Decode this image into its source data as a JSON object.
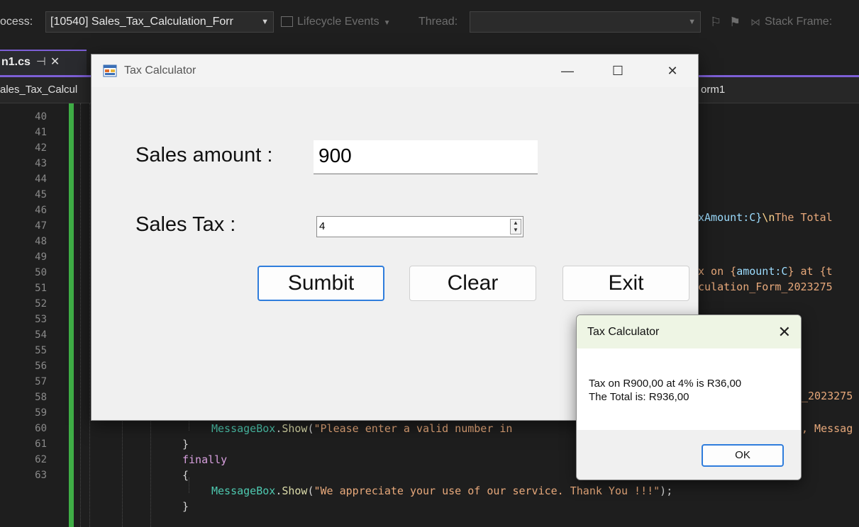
{
  "toolbar": {
    "process_label": "ocess:",
    "process_value": "[10540] Sales_Tax_Calculation_Forr",
    "lifecycle_label": "Lifecycle Events",
    "thread_label": "Thread:",
    "thread_value": "",
    "stackframe_label": "Stack Frame:"
  },
  "tab": {
    "name": "n1.cs",
    "pin": "⊣",
    "close": "✕"
  },
  "navbar": {
    "left": "ales_Tax_Calcul",
    "right": "orm1"
  },
  "editor": {
    "line_numbers": [
      "40",
      "41",
      "42",
      "43",
      "44",
      "45",
      "46",
      "47",
      "48",
      "49",
      "50",
      "51",
      "52",
      "53",
      "54",
      "55",
      "56",
      "57",
      "58",
      "59",
      "60",
      "61",
      "62",
      "63"
    ],
    "frag_46": "xAmount:C}",
    "frag_46_esc": "\\n",
    "frag_46_tail": "The Total",
    "frag_49_a": "x on {",
    "frag_49_b": "amount:C",
    "frag_49_c": "} at {t",
    "frag_50": "culation_Form_2023275",
    "frag_56": "_2023275",
    "line58_call": "MessageBox",
    "line58_dot": ".",
    "line58_method": "Show",
    "line58_paren": "(",
    "line58_string": "\"Please enter a valid number in",
    "line58_tail": ", Messag",
    "line59": "}",
    "line60": "finally",
    "line61": "{",
    "line62_call": "MessageBox",
    "line62_dot": ".",
    "line62_method": "Show",
    "line62_paren": "(",
    "line62_string": "\"We appreciate your use of our service. Thank You !!!\"",
    "line62_end": ");",
    "line63": "}"
  },
  "main_window": {
    "title": "Tax Calculator",
    "minimize": "—",
    "maximize": "☐",
    "close": "✕",
    "sales_amount_label": "Sales amount :",
    "sales_amount_value": "900",
    "sales_tax_label": "Sales Tax :",
    "sales_tax_value": "4",
    "submit_label": "Sumbit",
    "clear_label": "Clear",
    "exit_label": "Exit"
  },
  "message_box": {
    "title": "Tax Calculator",
    "close": "✕",
    "line1": "Tax on R900,00 at 4% is R36,00",
    "line2": "The Total is: R936,00",
    "ok_label": "OK"
  },
  "colors": {
    "accent": "#7d5fd6",
    "change_bar": "#3fae46",
    "focus_blue": "#2f7ddc"
  }
}
